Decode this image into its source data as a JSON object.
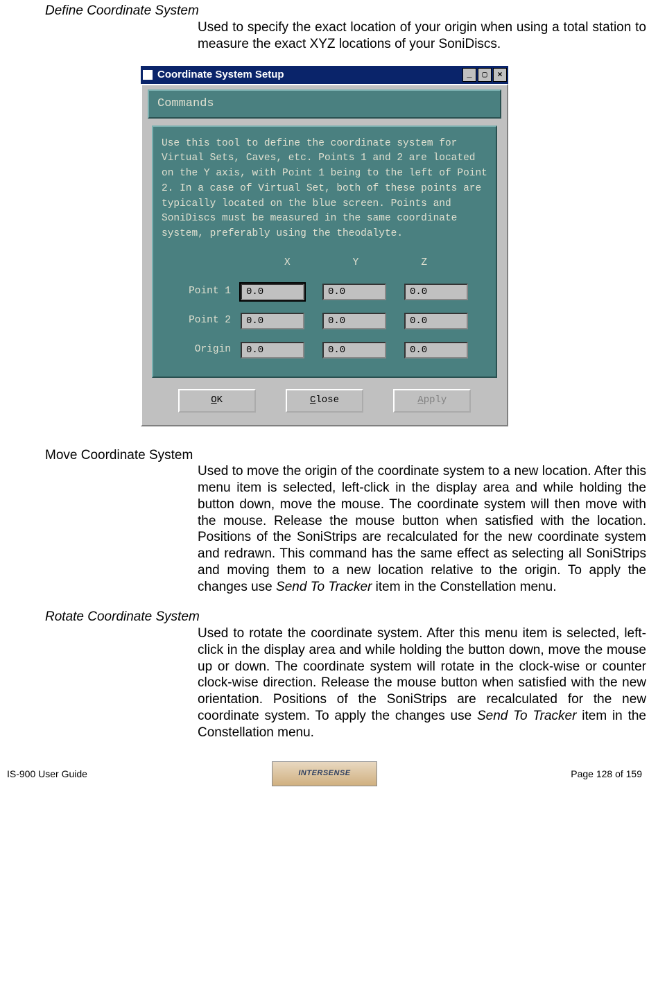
{
  "sections": {
    "define": {
      "title": "Define Coordinate System",
      "body": "Used to specify the exact location of your origin when using a total station to measure the exact XYZ locations of your SoniDiscs."
    },
    "move": {
      "title": "Move Coordinate System",
      "body_a": "Used to move the origin of the coordinate system to a new location.  After this menu item is selected, left-click in the display area and while holding the button down, move the mouse.  The coordinate system will then move with the mouse.  Release the mouse button when satisfied with the location.  Positions of the SoniStrips are recalculated for the new coordinate system and redrawn.  This command has the same effect as selecting all SoniStrips and moving them to a new location relative to the origin.  To apply the changes use ",
      "body_em": "Send To Tracker",
      "body_b": " item in the Constellation menu."
    },
    "rotate": {
      "title": "Rotate Coordinate System",
      "body_a": "Used to rotate the coordinate system.  After this menu item is selected, left-click in the display area and while holding the button down, move the mouse up or down.  The coordinate system will rotate in the clock-wise or counter clock-wise direction.  Release the mouse button when satisfied with the new orientation.  Positions of the SoniStrips are recalculated for the new coordinate system.  To apply the changes use ",
      "body_em": "Send To Tracker",
      "body_b": " item in the Constellation menu."
    }
  },
  "dialog": {
    "title": "Coordinate System Setup",
    "menu": "Commands",
    "help": "Use this tool to define the coordinate system for Virtual Sets, Caves, etc. Points 1 and 2 are located on the Y axis, with Point 1 being to the left of Point 2. In a case of Virtual Set, both of these points are typically located on the blue screen. Points and SoniDiscs must be measured in the same coordinate system, preferably using the theodalyte.",
    "headers": {
      "x": "X",
      "y": "Y",
      "z": "Z"
    },
    "rows": [
      {
        "label": "Point 1",
        "x": "0.0",
        "y": "0.0",
        "z": "0.0"
      },
      {
        "label": "Point 2",
        "x": "0.0",
        "y": "0.0",
        "z": "0.0"
      },
      {
        "label": "Origin",
        "x": "0.0",
        "y": "0.0",
        "z": "0.0"
      }
    ],
    "buttons": {
      "ok": {
        "pre": "",
        "u": "O",
        "post": "K"
      },
      "close": {
        "pre": "",
        "u": "C",
        "post": "lose"
      },
      "apply": {
        "pre": "",
        "u": "A",
        "post": "pply"
      }
    },
    "winbtns": {
      "min": "_",
      "restore": "▢",
      "close": "×"
    }
  },
  "footer": {
    "left": "IS-900 User Guide",
    "right": "Page 128 of 159",
    "logo": "INTERSENSE"
  }
}
